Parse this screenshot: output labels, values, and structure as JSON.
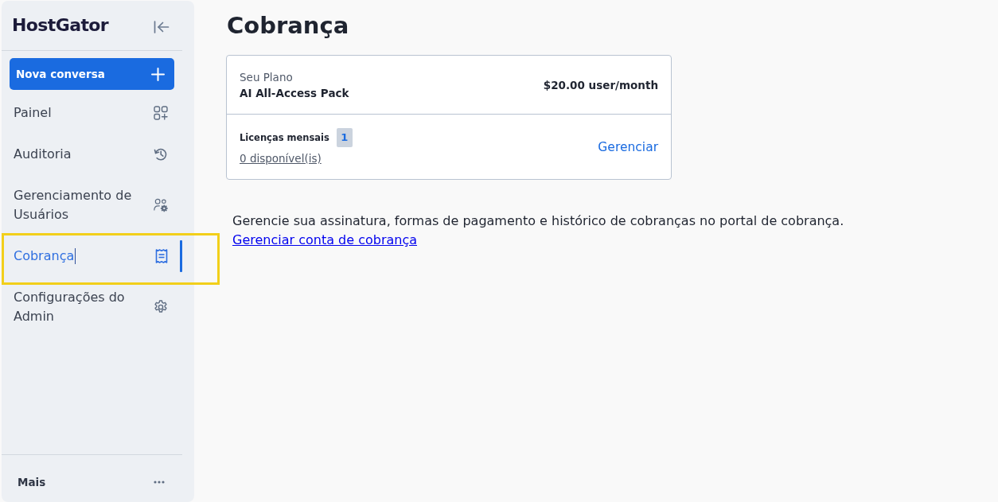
{
  "sidebar": {
    "logo": "HostGator",
    "new_chat_button": "Nova conversa",
    "items": [
      {
        "label": "Painel",
        "selected": false,
        "highlighted": false,
        "cursor": false
      },
      {
        "label": "Auditoria",
        "selected": false,
        "highlighted": false,
        "cursor": false
      },
      {
        "label": "Gerenciamento de Usuários",
        "selected": false,
        "highlighted": false,
        "cursor": false
      },
      {
        "label": "Cobrança",
        "selected": true,
        "highlighted": true,
        "cursor": true
      },
      {
        "label": "Configurações do Admin",
        "selected": false,
        "highlighted": false,
        "cursor": false
      }
    ],
    "footer_label": "Mais"
  },
  "page": {
    "title": "Cobrança",
    "plan_card": {
      "plan_label": "Seu Plano",
      "plan_name": "AI All-Access Pack",
      "price": "$20.00 user/month",
      "licenses_label": "Licenças mensais",
      "license_count": "1",
      "available_link": "0 disponível(is)",
      "manage_link": "Gerenciar"
    },
    "billing_note": {
      "text": "Gerencie sua assinatura, formas de pagamento e histórico de cobranças no portal de cobrança.",
      "link": "Gerenciar conta de cobrança"
    }
  }
}
